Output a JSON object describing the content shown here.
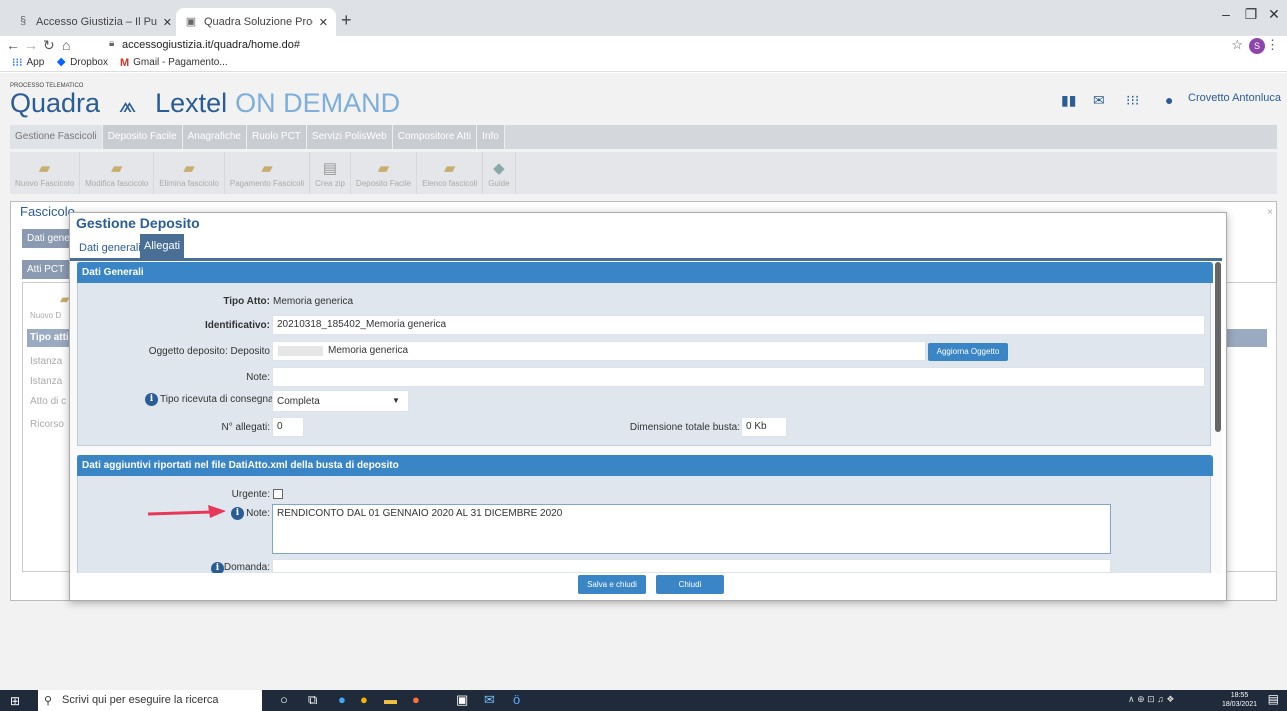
{
  "browser": {
    "tabs": [
      {
        "label": "Accesso Giustizia – Il Punto di Ac"
      },
      {
        "label": "Quadra Soluzione Processo Tele"
      }
    ],
    "url": "accessogiustizia.it/quadra/home.do#",
    "profile_initial": "S",
    "bookmarks": [
      {
        "label": "App"
      },
      {
        "label": "Dropbox"
      },
      {
        "label": "Gmail - Pagamento..."
      }
    ]
  },
  "app": {
    "brand_small": "PROCESSO TELEMATICO",
    "brand_name": "Quadra",
    "brand_lextel": "Lextel",
    "brand_on_demand": "ON DEMAND",
    "user": "Crovetto Antonluca",
    "menu": [
      "Gestione Fascicoli",
      "Deposito Facile",
      "Anagrafiche",
      "Ruolo PCT",
      "Servizi PolisWeb",
      "Compositore Atti",
      "Info"
    ],
    "toolbar": [
      "Nuovo Fascicolo",
      "Modifica fascicolo",
      "Elimina fascicolo",
      "Pagamento Fascicoli",
      "Crea zip",
      "Deposito Facile",
      "Elenco fascicoli",
      "Guide"
    ],
    "background": {
      "title": "Fascicolo",
      "tab1": "Dati gene",
      "tab2": "Atti PCT",
      "nuovo": "Nuovo D",
      "col": "Tipo atti",
      "rows": [
        "Istanza",
        "Istanza",
        "Atto di c",
        "Ricorso"
      ]
    }
  },
  "modal": {
    "title": "Gestione Deposito",
    "tabs": [
      "Dati generali",
      "Allegati"
    ],
    "sec1_title": "Dati Generali",
    "tipo_atto_label": "Tipo Atto:",
    "tipo_atto_value": "Memoria generica",
    "identificativo_label": "Identificativo:",
    "identificativo_value": "20210318_185402_Memoria generica",
    "oggetto_label": "Oggetto deposito: Deposito",
    "oggetto_value": "Memoria generica",
    "aggiorna_button": "Aggiorna Oggetto",
    "note_label": "Note:",
    "note_value": "",
    "ricevuta_label": "Tipo ricevuta di consegna:",
    "ricevuta_value": "Completa",
    "allegati_label": "N° allegati:",
    "allegati_value": "0",
    "dimensione_label": "Dimensione totale busta:",
    "dimensione_value": "0 Kb",
    "sec2_title": "Dati aggiuntivi riportati nel file DatiAtto.xml della busta di deposito",
    "urgente_label": "Urgente:",
    "note2_label": "Note:",
    "note2_value": "RENDICONTO DAL 01 GENNAIO 2020 AL 31 DICEMBRE 2020",
    "domanda_label": "Domanda:",
    "save_button": "Salva e chiudi",
    "close_button": "Chiudi"
  },
  "taskbar": {
    "search_placeholder": "Scrivi qui per eseguire la ricerca",
    "time": "18:55",
    "date": "18/03/2021"
  },
  "colors": {
    "brand": "#2a5d96",
    "section_header": "#3a85c6",
    "arrow": "#e8385a"
  }
}
